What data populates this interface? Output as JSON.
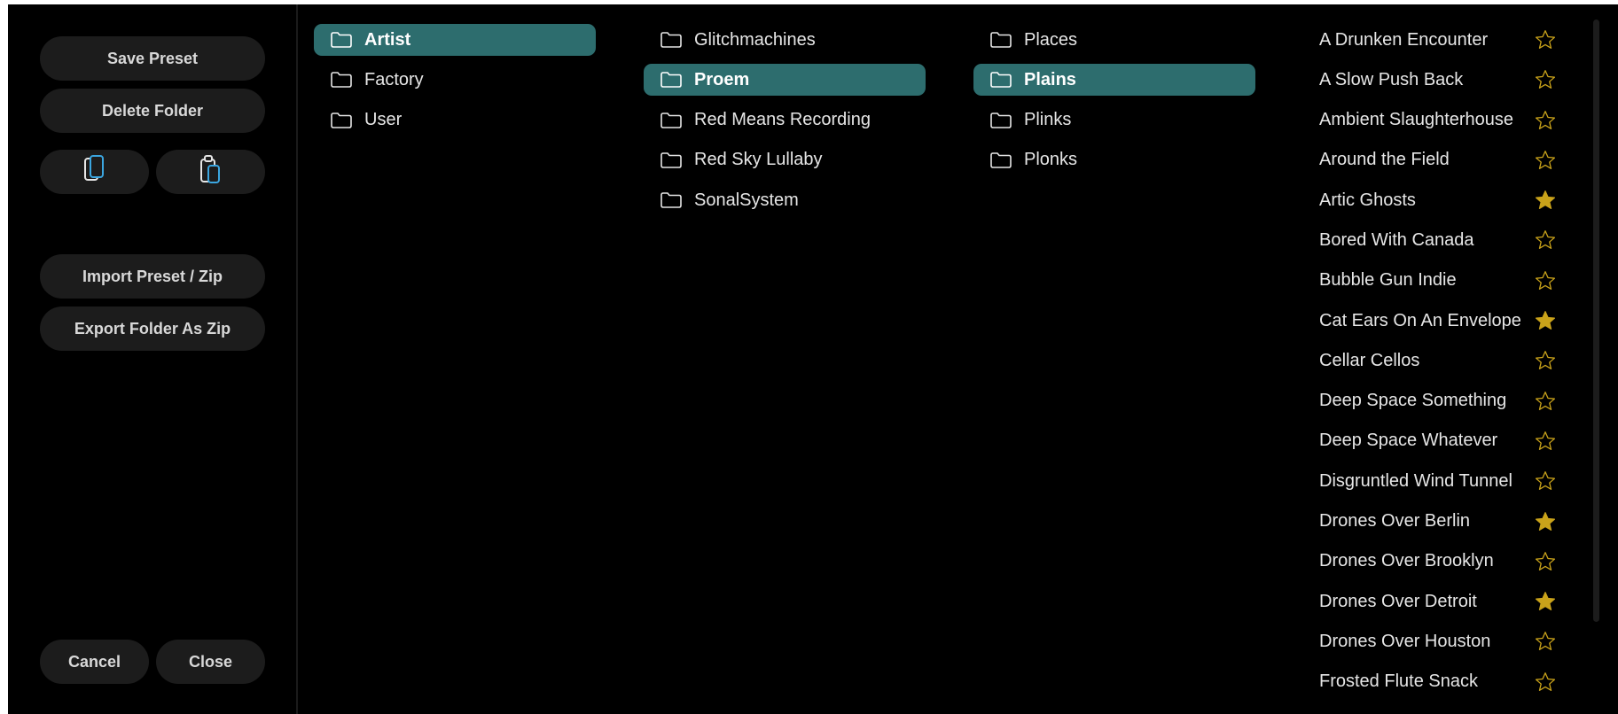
{
  "sidebar": {
    "save_preset": "Save Preset",
    "delete_folder": "Delete Folder",
    "import_preset": "Import Preset / Zip",
    "export_folder": "Export Folder As Zip",
    "cancel": "Cancel",
    "close": "Close",
    "copy_icon": "copy-icon",
    "paste_icon": "paste-icon"
  },
  "colors": {
    "selected": "#2d6d6e",
    "star_gold": "#c9a21a",
    "button_bg": "#1c1c1c"
  },
  "columns": {
    "col1": [
      {
        "label": "Artist",
        "selected": true
      },
      {
        "label": "Factory",
        "selected": false
      },
      {
        "label": "User",
        "selected": false
      }
    ],
    "col2": [
      {
        "label": "Glitchmachines",
        "selected": false
      },
      {
        "label": "Proem",
        "selected": true
      },
      {
        "label": "Red Means Recording",
        "selected": false
      },
      {
        "label": "Red Sky Lullaby",
        "selected": false
      },
      {
        "label": "SonalSystem",
        "selected": false
      }
    ],
    "col3": [
      {
        "label": "Places",
        "selected": false
      },
      {
        "label": "Plains",
        "selected": true
      },
      {
        "label": "Plinks",
        "selected": false
      },
      {
        "label": "Plonks",
        "selected": false
      }
    ]
  },
  "presets": [
    {
      "label": "A Drunken Encounter",
      "favorite": false
    },
    {
      "label": "A Slow Push Back",
      "favorite": false
    },
    {
      "label": "Ambient Slaughterhouse",
      "favorite": false
    },
    {
      "label": "Around the Field",
      "favorite": false
    },
    {
      "label": "Artic Ghosts",
      "favorite": true
    },
    {
      "label": "Bored With Canada",
      "favorite": false
    },
    {
      "label": "Bubble Gun Indie",
      "favorite": false
    },
    {
      "label": "Cat Ears On An Envelope",
      "favorite": true
    },
    {
      "label": "Cellar Cellos",
      "favorite": false
    },
    {
      "label": "Deep Space Something",
      "favorite": false
    },
    {
      "label": "Deep Space Whatever",
      "favorite": false
    },
    {
      "label": "Disgruntled Wind Tunnel",
      "favorite": false
    },
    {
      "label": "Drones Over Berlin",
      "favorite": true
    },
    {
      "label": "Drones Over Brooklyn",
      "favorite": false
    },
    {
      "label": "Drones Over Detroit",
      "favorite": true
    },
    {
      "label": "Drones Over Houston",
      "favorite": false
    },
    {
      "label": "Frosted Flute Snack",
      "favorite": false
    }
  ]
}
